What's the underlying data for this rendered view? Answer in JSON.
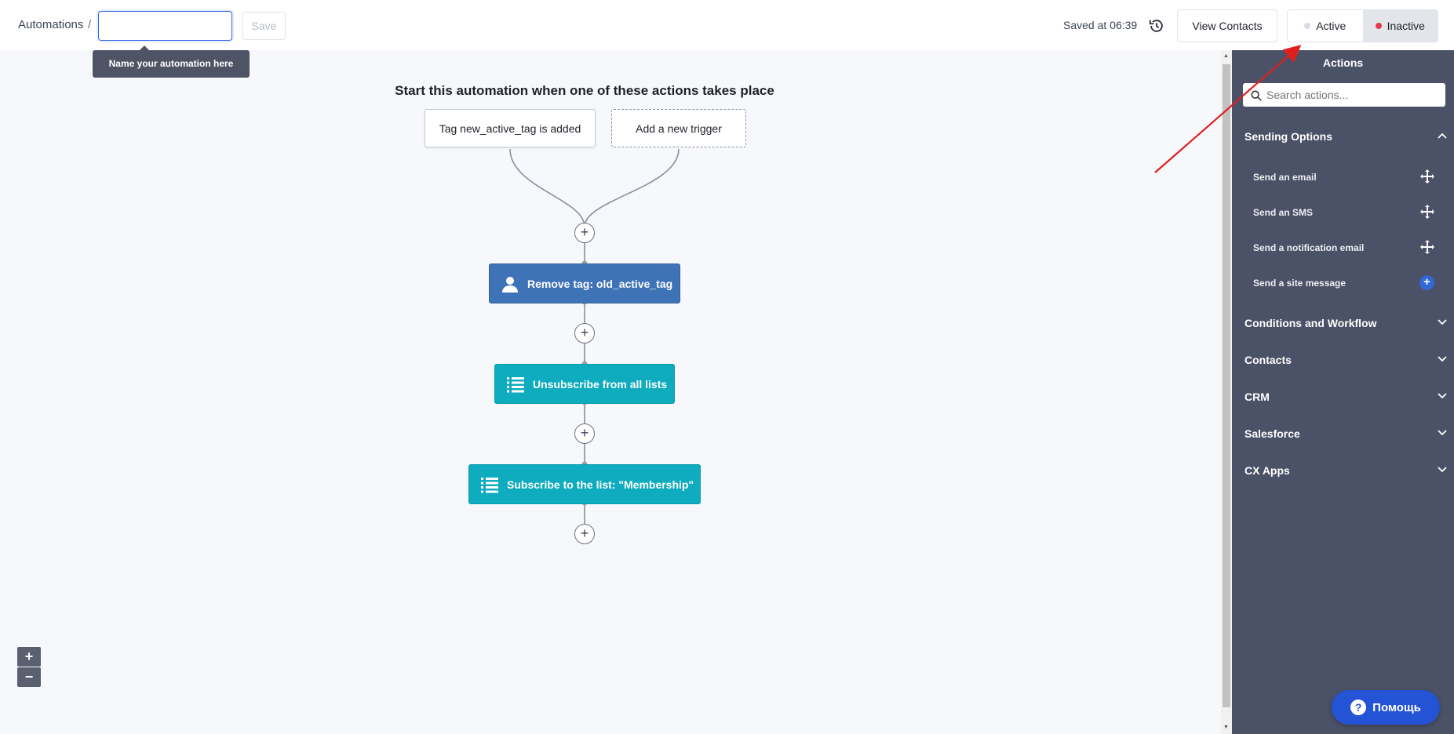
{
  "header": {
    "breadcrumb": "Automations",
    "breadcrumb_sep": "/",
    "name_input_value": "",
    "save_label": "Save",
    "tooltip": "Name your automation here",
    "saved_at": "Saved at 06:39",
    "view_contacts": "View Contacts",
    "status_options": [
      {
        "label": "Active",
        "color": "#d8dce3"
      },
      {
        "label": "Inactive",
        "color": "#e8384f"
      }
    ]
  },
  "canvas": {
    "title": "Start this automation when one of these actions takes place",
    "triggers": [
      {
        "label": "Tag new_active_tag is added"
      },
      {
        "label": "Add a new trigger"
      }
    ],
    "steps": [
      {
        "label": "Remove tag: old_active_tag",
        "icon": "user-icon",
        "color": "#3f73b8"
      },
      {
        "label": "Unsubscribe from all lists",
        "icon": "list-icon",
        "color": "#0eacbe"
      },
      {
        "label": "Subscribe to the list: \"Membership\"",
        "icon": "list-icon",
        "color": "#0eacbe"
      }
    ],
    "add_step_symbol": "+",
    "zoom_in": "+",
    "zoom_out": "−"
  },
  "sidebar": {
    "title": "Actions",
    "search_placeholder": "Search actions...",
    "sections": [
      {
        "label": "Sending Options",
        "expanded": true,
        "items": [
          {
            "label": "Send an email",
            "icon": "move-icon"
          },
          {
            "label": "Send an SMS",
            "icon": "move-icon"
          },
          {
            "label": "Send a notification email",
            "icon": "move-icon"
          },
          {
            "label": "Send a site message",
            "icon": "plus-icon"
          }
        ]
      },
      {
        "label": "Conditions and Workflow",
        "expanded": false
      },
      {
        "label": "Contacts",
        "expanded": false
      },
      {
        "label": "CRM",
        "expanded": false
      },
      {
        "label": "Salesforce",
        "expanded": false
      },
      {
        "label": "CX Apps",
        "expanded": false
      }
    ]
  },
  "help": {
    "label": "Помощь",
    "symbol": "?"
  },
  "colors": {
    "accent": "#356ae6",
    "sidebar_bg": "#4b5166",
    "annotation_arrow": "#e01f1f"
  }
}
